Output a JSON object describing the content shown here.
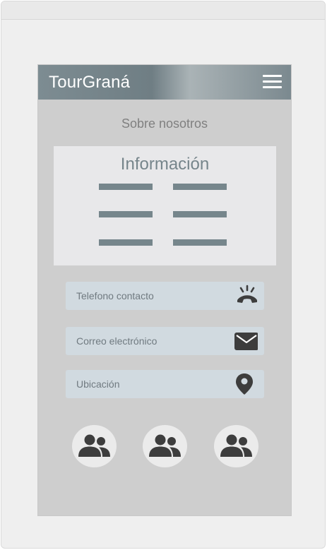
{
  "app": {
    "title": "TourGraná"
  },
  "header": {
    "menu_icon": "hamburger-menu-icon"
  },
  "section": {
    "title": "Sobre nosotros"
  },
  "info_card": {
    "title": "Información",
    "placeholder_lines": 6
  },
  "fields": [
    {
      "label": "Telefono contacto",
      "icon": "phone-icon"
    },
    {
      "label": "Correo electrónico",
      "icon": "mail-icon"
    },
    {
      "label": "Ubicación",
      "icon": "location-pin-icon"
    }
  ],
  "contacts": [
    {
      "icon": "group-icon"
    },
    {
      "icon": "group-icon"
    },
    {
      "icon": "group-icon"
    }
  ],
  "colors": {
    "appbar": "#76868c",
    "screen_bg": "#cecece",
    "card_bg": "#e8e8ea",
    "accent": "#76858b",
    "field_bg": "#d1dae0",
    "icon_dark": "#3d3d3d"
  }
}
